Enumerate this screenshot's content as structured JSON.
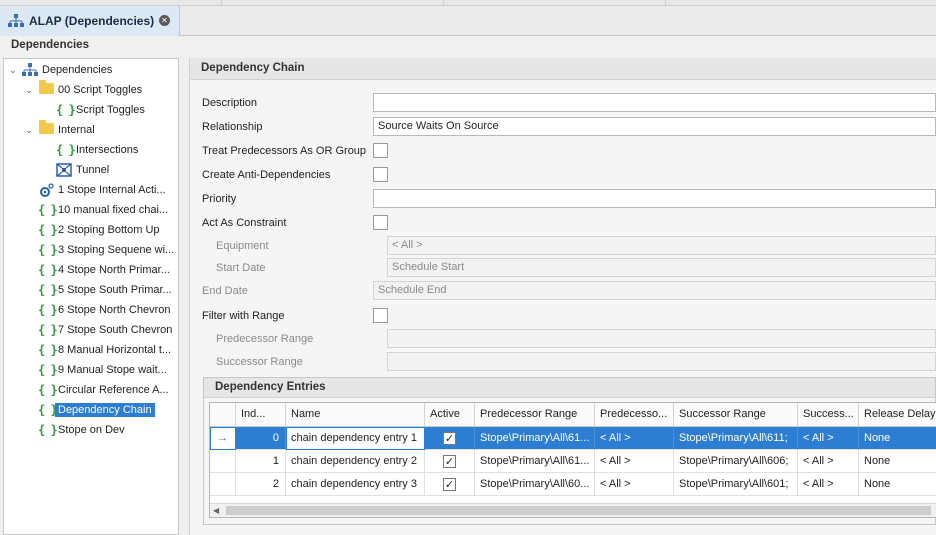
{
  "tab": {
    "title": "ALAP (Dependencies)",
    "icon": "hierarchy-icon",
    "close_icon": "close-icon"
  },
  "header": {
    "title": "Dependencies"
  },
  "tree": {
    "root": "Dependencies",
    "items": [
      {
        "label": "00 Script Toggles",
        "icon": "folder-icon"
      },
      {
        "label": "Script Toggles",
        "icon": "script-braces-icon"
      },
      {
        "label": "Internal",
        "icon": "folder-icon"
      },
      {
        "label": "Intersections",
        "icon": "script-braces-icon"
      },
      {
        "label": "Tunnel",
        "icon": "tunnel-icon"
      },
      {
        "label": "1 Stope Internal Acti...",
        "icon": "gear-script-icon"
      },
      {
        "label": "10 manual fixed chai...",
        "icon": "script-braces-icon"
      },
      {
        "label": "2 Stoping Bottom Up",
        "icon": "script-braces-icon"
      },
      {
        "label": "3 Stoping Sequene wi...",
        "icon": "script-braces-icon"
      },
      {
        "label": "4 Stope North Primar...",
        "icon": "script-braces-icon"
      },
      {
        "label": "5 Stope South Primar...",
        "icon": "script-braces-icon"
      },
      {
        "label": "6 Stope North Chevron",
        "icon": "script-braces-icon"
      },
      {
        "label": "7 Stope South Chevron",
        "icon": "script-braces-icon"
      },
      {
        "label": "8 Manual Horizontal t...",
        "icon": "script-braces-icon"
      },
      {
        "label": "9 Manual Stope wait...",
        "icon": "script-braces-icon"
      },
      {
        "label": "Circular Reference A...",
        "icon": "script-braces-icon"
      },
      {
        "label": "Dependency Chain",
        "icon": "script-braces-icon"
      },
      {
        "label": "Stope on Dev",
        "icon": "script-braces-icon"
      }
    ],
    "selected": "Dependency Chain"
  },
  "panel": {
    "title": "Dependency Chain",
    "fields": {
      "description": {
        "label": "Description",
        "value": ""
      },
      "relationship": {
        "label": "Relationship",
        "value": "Source Waits On Source"
      },
      "treat_or": {
        "label": "Treat Predecessors As OR Group"
      },
      "anti": {
        "label": "Create Anti-Dependencies"
      },
      "priority": {
        "label": "Priority",
        "value": ""
      },
      "constraint": {
        "label": "Act As Constraint"
      },
      "equipment": {
        "label": "Equipment",
        "value": "< All >"
      },
      "start_date": {
        "label": "Start Date",
        "value": "Schedule Start"
      },
      "end_date": {
        "label": "End Date",
        "value": "Schedule End"
      },
      "filter_range": {
        "label": "Filter with Range"
      },
      "pred_range": {
        "label": "Predecessor Range",
        "value": ""
      },
      "succ_range": {
        "label": "Successor Range",
        "value": ""
      }
    }
  },
  "entries": {
    "title": "Dependency Entries",
    "columns": [
      "Ind...",
      "Name",
      "Active",
      "Predecessor Range",
      "Predecesso...",
      "Successor Range",
      "Success...",
      "Release Delay"
    ],
    "rows": [
      {
        "index": "0",
        "name": "chain dependency entry 1",
        "active": "✓",
        "pred_range": "Stope\\Primary\\All\\61...",
        "pred": "< All >",
        "succ_range": "Stope\\Primary\\All\\611;",
        "succ": "< All >",
        "delay": "None"
      },
      {
        "index": "1",
        "name": "chain dependency entry 2",
        "active": "✓",
        "pred_range": "Stope\\Primary\\All\\61...",
        "pred": "< All >",
        "succ_range": "Stope\\Primary\\All\\606;",
        "succ": "< All >",
        "delay": "None"
      },
      {
        "index": "2",
        "name": "chain dependency entry 3",
        "active": "✓",
        "pred_range": "Stope\\Primary\\All\\60...",
        "pred": "< All >",
        "succ_range": "Stope\\Primary\\All\\601;",
        "succ": "< All >",
        "delay": "None"
      }
    ],
    "row_indicator": "→"
  }
}
